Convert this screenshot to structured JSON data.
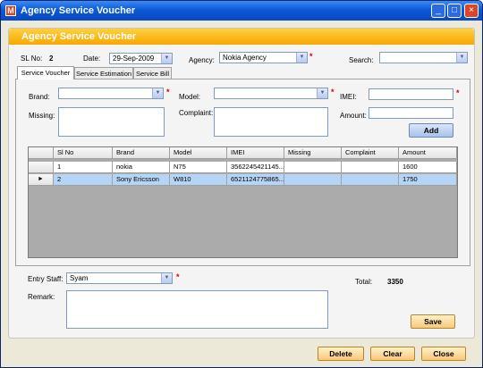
{
  "window": {
    "title": "Agency Service Voucher",
    "app_icon": "M",
    "controls": [
      "_",
      "□",
      "×"
    ]
  },
  "banner": {
    "title": "Agency Service Voucher"
  },
  "header": {
    "slno_label": "SL No:",
    "slno_value": "2",
    "date_label": "Date:",
    "date_value": "29-Sep-2009",
    "agency_label": "Agency:",
    "agency_value": "Nokia Agency",
    "search_label": "Search:",
    "search_value": ""
  },
  "tabs": [
    {
      "label": "Service Voucher",
      "active": true
    },
    {
      "label": "Service Estimation",
      "active": false
    },
    {
      "label": "Service Bill",
      "active": false
    }
  ],
  "form": {
    "brand_label": "Brand:",
    "brand_value": "",
    "model_label": "Model:",
    "model_value": "",
    "imei_label": "IMEI:",
    "imei_value": "",
    "missing_label": "Missing:",
    "missing_value": "",
    "complaint_label": "Complaint:",
    "complaint_value": "",
    "amount_label": "Amount:",
    "amount_value": "",
    "add_label": "Add",
    "required_mark": "*"
  },
  "table": {
    "columns": [
      "Sl No",
      "Brand",
      "Model",
      "IMEI",
      "Missing",
      "Complaint",
      "Amount"
    ],
    "rows": [
      [
        "1",
        "nokia",
        "N75",
        "3562245421145...",
        "",
        "",
        "1600"
      ],
      [
        "2",
        "Sony Ericsson",
        "W810",
        "6521124775865...",
        "",
        "",
        "1750"
      ]
    ],
    "selected_row": 1,
    "current_row_marker": "►"
  },
  "footer": {
    "entry_staff_label": "Entry Staff:",
    "entry_staff_value": "Syam",
    "remark_label": "Remark:",
    "remark_value": "",
    "total_label": "Total:",
    "total_value": "3350",
    "save_label": "Save"
  },
  "actions": {
    "delete_label": "Delete",
    "clear_label": "Clear",
    "close_label": "Close"
  },
  "colors": {
    "banner": "#f5a800",
    "titlebar": "#0a5ad8",
    "selected_row": "#b5d5f6",
    "required": "#d00000"
  }
}
